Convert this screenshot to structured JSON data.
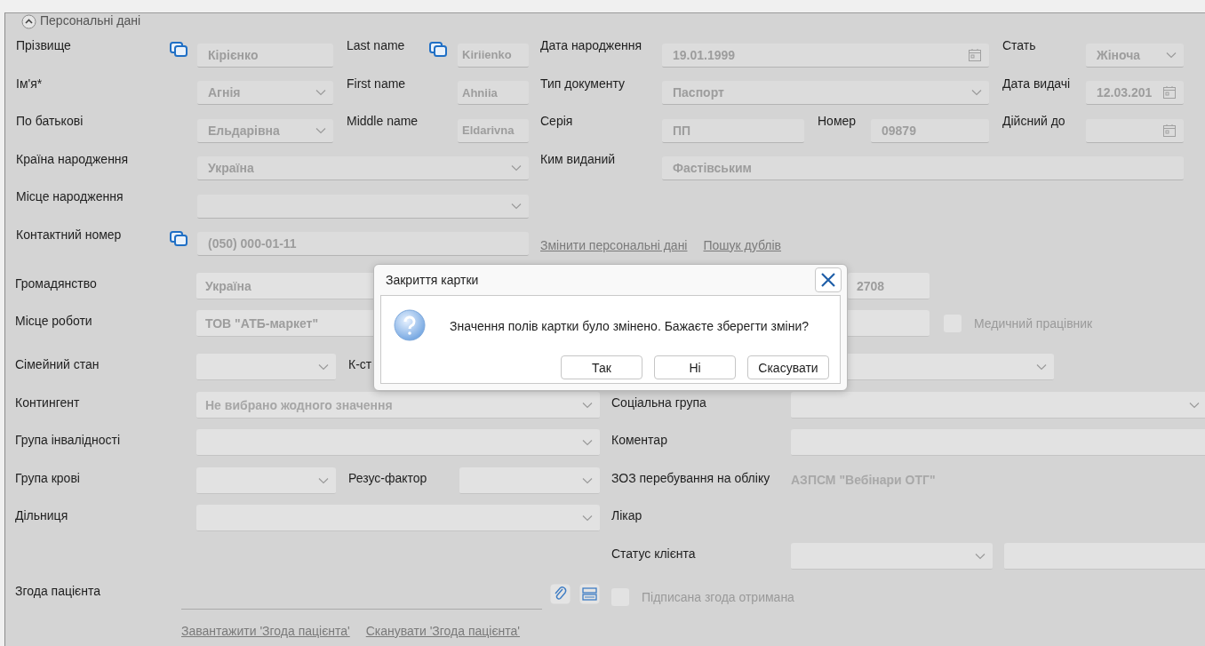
{
  "section": {
    "title": "Персональні дані",
    "expanded": true
  },
  "top_rows": [
    {
      "items": [
        {
          "kind": "label",
          "text": "Прізвище"
        },
        {
          "kind": "copy_button"
        },
        {
          "kind": "text",
          "value": "Кірієнко"
        },
        {
          "kind": "label",
          "text": "Last name"
        },
        {
          "kind": "copy_button"
        },
        {
          "kind": "text",
          "value": "Kiriienko"
        },
        {
          "kind": "label",
          "text": "Дата народження"
        },
        {
          "kind": "date",
          "value": "19.01.1999"
        },
        {
          "kind": "label",
          "text": "Стать"
        },
        {
          "kind": "combo",
          "value": "Жіноча"
        }
      ]
    },
    {
      "items": [
        {
          "kind": "label",
          "text": "Ім'я*"
        },
        {
          "kind": "combo",
          "value": "Агнія"
        },
        {
          "kind": "label",
          "text": "First name"
        },
        {
          "kind": "text",
          "value": "Ahniia"
        },
        {
          "kind": "label",
          "text": "Тип документу"
        },
        {
          "kind": "combo",
          "value": "Паспорт"
        },
        {
          "kind": "label",
          "text": "Дата видачі"
        },
        {
          "kind": "date",
          "value": "12.03.201"
        }
      ]
    },
    {
      "items": [
        {
          "kind": "label",
          "text": "По батькові"
        },
        {
          "kind": "combo",
          "value": "Ельдарівна"
        },
        {
          "kind": "label",
          "text": "Middle name"
        },
        {
          "kind": "text",
          "value": "Eldarivna"
        },
        {
          "kind": "label",
          "text": "Серія"
        },
        {
          "kind": "text",
          "value": "ПП"
        },
        {
          "kind": "label",
          "text": "Номер"
        },
        {
          "kind": "text",
          "value": "09879"
        },
        {
          "kind": "label",
          "text": "Дійсний до"
        },
        {
          "kind": "date"
        }
      ]
    },
    {
      "items": [
        {
          "kind": "label",
          "text": "Країна народження"
        },
        {
          "kind": "combo",
          "value": "Україна"
        },
        {
          "kind": "label",
          "text": "Ким виданий"
        },
        {
          "kind": "text",
          "value": "Фастівським"
        }
      ]
    },
    {
      "items": [
        {
          "kind": "label",
          "text": "Місце народження"
        },
        {
          "kind": "combo"
        }
      ]
    },
    {
      "items": [
        {
          "kind": "label",
          "text": "Контактний номер"
        },
        {
          "kind": "copy_button"
        },
        {
          "kind": "text",
          "value": "(050) 000-01-11"
        },
        {
          "kind": "links",
          "links": [
            "Змінити персональні дані",
            "Пошук дублів"
          ]
        }
      ]
    }
  ],
  "bottom_rows": [
    {
      "items": [
        {
          "kind": "label",
          "text": "Громадянство"
        },
        {
          "kind": "text",
          "value": "Україна"
        },
        {
          "kind": "text",
          "value": "2708"
        }
      ]
    },
    {
      "items": [
        {
          "kind": "label",
          "text": "Місце роботи"
        },
        {
          "kind": "text",
          "value": "ТОВ \"АТБ-маркет\""
        },
        {
          "kind": "text"
        },
        {
          "kind": "checkbox",
          "text": "Медичний працівник",
          "checked": false
        }
      ]
    },
    {
      "items": [
        {
          "kind": "label",
          "text": "Сімейний стан"
        },
        {
          "kind": "combo"
        },
        {
          "kind": "label",
          "text": "К-ст"
        },
        {
          "kind": "combo"
        }
      ]
    },
    {
      "items": [
        {
          "kind": "label",
          "text": "Контингент"
        },
        {
          "kind": "combo",
          "placeholder": "Не вибрано жодного значення"
        },
        {
          "kind": "label",
          "text": "Соціальна група"
        },
        {
          "kind": "combo"
        }
      ]
    },
    {
      "items": [
        {
          "kind": "label",
          "text": "Група інвалідності"
        },
        {
          "kind": "combo"
        },
        {
          "kind": "label",
          "text": "Коментар"
        },
        {
          "kind": "text"
        }
      ]
    },
    {
      "items": [
        {
          "kind": "label",
          "text": "Група крові"
        },
        {
          "kind": "combo"
        },
        {
          "kind": "label",
          "text": "Резус-фактор"
        },
        {
          "kind": "combo"
        },
        {
          "kind": "label",
          "text": "ЗОЗ перебування на обліку"
        },
        {
          "kind": "value",
          "text": "АЗПСМ \"Вебінари ОТГ\""
        }
      ]
    },
    {
      "items": [
        {
          "kind": "label",
          "text": "Дільниця"
        },
        {
          "kind": "combo"
        },
        {
          "kind": "label",
          "text": "Лікар"
        }
      ]
    },
    {
      "items": [
        {
          "kind": "label",
          "text": "Статус клієнта"
        },
        {
          "kind": "combo"
        },
        {
          "kind": "text"
        }
      ]
    },
    {
      "items": [
        {
          "kind": "label",
          "text": "Згода пацієнта"
        },
        {
          "kind": "line_field"
        },
        {
          "kind": "attach_button"
        },
        {
          "kind": "scan_button"
        },
        {
          "kind": "checkbox",
          "text": "Підписана згода отримана",
          "checked": false
        }
      ]
    },
    {
      "items": [
        {
          "kind": "links",
          "links": [
            "Завантажити 'Згода пацієнта'",
            "Сканувати 'Згода пацієнта'"
          ]
        }
      ]
    }
  ],
  "dialog": {
    "title": "Закриття картки",
    "message": "Значення полів картки було змінено. Бажаєте зберегти зміни?",
    "buttons": [
      "Так",
      "Ні",
      "Скасувати"
    ]
  }
}
